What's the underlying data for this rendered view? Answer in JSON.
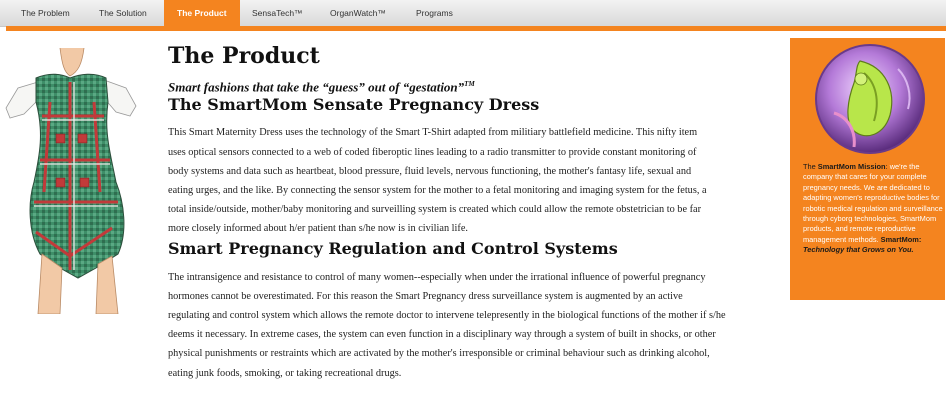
{
  "nav": {
    "items": [
      "The Problem",
      "The Solution",
      "The Product",
      "SensaTech™",
      "OrganWatch™",
      "Programs"
    ],
    "active": "The Product"
  },
  "page": {
    "title": "The Product",
    "tagline": "Smart fashions that take the “guess” out of “gestation”",
    "tagline_mark": "TM"
  },
  "dress": {
    "heading": "The SmartMom Sensate Pregnancy Dress",
    "lines": [
      "This Smart Maternity Dress uses the technology of the Smart T-Shirt adapted from militiary battlefield medicine. This nifty item",
      "uses optical sensors connected to a web of coded fiberoptic lines leading to a radio transmitter to provide constant monitoring of",
      "body systems and data such as heartbeat, blood pressure, fluid levels, nervous functioning, the mother's fantasy life, sexual and",
      "eating urges, and the like. By connecting the sensor system for the mother to a fetal monitoring and imaging system for the fetus, a",
      "total inside/outside, mother/baby monitoring and surveilling system is created which could allow the remote obstetrician to be far",
      "more closely informed about h/er patient than s/he now is in civilian life."
    ]
  },
  "regulation": {
    "heading": "Smart Pregnancy Regulation and Control Systems",
    "lines": [
      "The intransigence and resistance to control of many women--especially when under the irrational influence of powerful pregnancy",
      "hormones cannot be overestimated. For this reason the Smart Pregnancy dress surveillance system is augmented by an active",
      "regulating and control system which allows the remote doctor to intervene telepresently in the biological functions of the mother if s/he",
      "deems it necessary. In extreme cases, the system can even function in a disciplinary way through a system of built in shocks, or other",
      "physical punishments or restraints which are activated by the mother's irresponsible or criminal behaviour such as drinking alcohol,",
      "eating junk foods, smoking, or taking recreational drugs."
    ]
  },
  "sidebar": {
    "mission_prefix": "The ",
    "mission_name": "SmartMom Mission",
    "mission_colon": ":",
    "mission_text": "we're the company that cares for your complete pregnancy needs. We are dedicated to adapting women's reproductive bodies for robotic medical regulation and surveillance through cyborg technologies, SmartMom products, and remote reproductive management methods.",
    "brand": "SmartMom:",
    "slogan": "Technology that Grows on You."
  },
  "colors": {
    "accent": "#f4841f",
    "nav_bg": "#e6e6e6",
    "text": "#222222"
  }
}
